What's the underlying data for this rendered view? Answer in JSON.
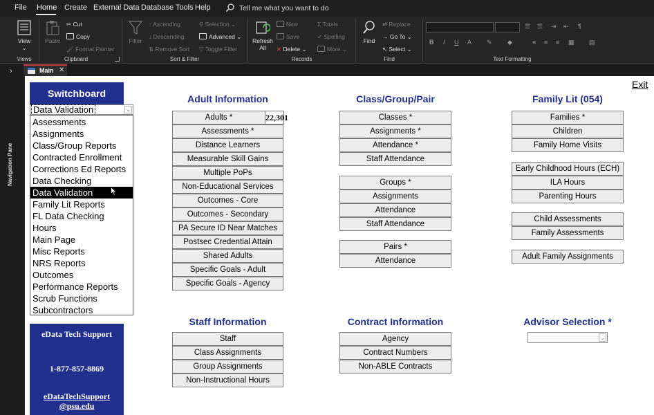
{
  "menu": {
    "items": [
      "File",
      "Home",
      "Create",
      "External Data",
      "Database Tools",
      "Help"
    ],
    "tell_me": "Tell me what you want to do"
  },
  "ribbon": {
    "views": {
      "view": "View",
      "label": "Views"
    },
    "clipboard": {
      "paste": "Paste",
      "cut": "Cut",
      "copy": "Copy",
      "format_painter": "Format Painter",
      "label": "Clipboard"
    },
    "sort_filter": {
      "filter": "Filter",
      "ascending": "Ascending",
      "descending": "Descending",
      "remove_sort": "Remove Sort",
      "selection": "Selection",
      "advanced": "Advanced",
      "toggle_filter": "Toggle Filter",
      "label": "Sort & Filter"
    },
    "records": {
      "refresh_all": "Refresh All",
      "new": "New",
      "save": "Save",
      "delete": "Delete",
      "totals": "Totals",
      "spelling": "Spelling",
      "more": "More",
      "label": "Records"
    },
    "find": {
      "find": "Find",
      "replace": "Replace",
      "go_to": "Go To",
      "select": "Select",
      "label": "Find"
    },
    "text_formatting": {
      "label": "Text Formatting",
      "bold": "B",
      "italic": "I",
      "underline": "U"
    }
  },
  "nav_pane": {
    "label": "Navigation Pane"
  },
  "doc_tab": {
    "label": "Main"
  },
  "form": {
    "exit": "Exit",
    "switchboard": {
      "title": "Switchboard",
      "selected": "Data Validation",
      "options": [
        "Assessments",
        "Assignments",
        "Class/Group Reports",
        "Contracted Enrollment",
        "Corrections Ed Reports",
        "Data Checking",
        "Data Validation",
        "Family Lit Reports",
        "FL Data Checking",
        "Hours",
        "Main Page",
        "Misc Reports",
        "NRS Reports",
        "Outcomes",
        "Performance Reports",
        "Scrub Functions",
        "Subcontractors"
      ]
    },
    "support": {
      "title": "eData Tech Support",
      "phone": "1-877-857-8869",
      "email": "eDataTechSupport @psu.edu"
    },
    "adult": {
      "title": "Adult Information",
      "adults": "Adults *",
      "adults_count": "22,301",
      "buttons": [
        "Assessments *",
        "Distance Learners",
        "Measurable Skill Gains",
        "Multiple PoPs",
        "Non-Educational Services",
        "Outcomes - Core",
        "Outcomes - Secondary",
        "PA Secure ID Near Matches",
        "Postsec Credential Attain",
        "Shared Adults",
        "Specific Goals - Adult",
        "Specific Goals - Agency"
      ]
    },
    "class": {
      "title": "Class/Group/Pair",
      "classes": [
        "Classes *",
        "Assignments *",
        "Attendance *",
        "Staff Attendance"
      ],
      "groups": [
        "Groups *",
        "Assignments",
        "Attendance",
        "Staff Attendance"
      ],
      "pairs": [
        "Pairs *",
        "Attendance"
      ]
    },
    "family": {
      "title": "Family Lit (054)",
      "group1": [
        "Families *",
        "Children",
        "Family Home Visits"
      ],
      "group2": [
        "Early Childhood Hours (ECH)",
        "ILA Hours",
        "Parenting Hours"
      ],
      "group3": [
        "Child Assessments",
        "Family Assessments"
      ],
      "group4": [
        "Adult Family Assignments"
      ]
    },
    "staff": {
      "title": "Staff  Information",
      "buttons": [
        "Staff",
        "Class Assignments",
        "Group Assignments",
        "Non-Instructional Hours"
      ]
    },
    "contract": {
      "title": "Contract  Information",
      "buttons": [
        "Agency",
        "Contract Numbers",
        "Non-ABLE Contracts"
      ]
    },
    "advisor": {
      "title": "Advisor Selection *",
      "value": ""
    }
  }
}
